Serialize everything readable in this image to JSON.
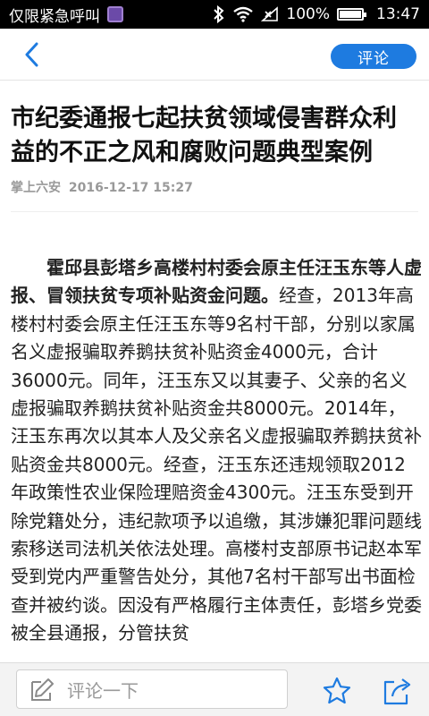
{
  "status_bar": {
    "carrier": "仅限紧急呼叫",
    "battery": "100%",
    "time": "13:47",
    "icons": [
      "app-icon",
      "bluetooth-icon",
      "wifi-icon",
      "no-signal-icon",
      "battery-icon"
    ]
  },
  "nav": {
    "back_icon": "chevron-left-icon",
    "comment_label": "评论"
  },
  "article": {
    "title": "市纪委通报七起扶贫领域侵害群众利益的不正之风和腐败问题典型案例",
    "source": "掌上六安",
    "datetime": "2016-12-17 15:27",
    "lead": "霍邱县彭塔乡高楼村村委会原主任汪玉东等人虚报、冒领扶贫专项补贴资金问题。",
    "body": "经查，2013年高楼村村委会原主任汪玉东等9名村干部，分别以家属名义虚报骗取养鹅扶贫补贴资金4000元，合计36000元。同年，汪玉东又以其妻子、父亲的名义虚报骗取养鹅扶贫补贴资金共8000元。2014年，汪玉东再次以其本人及父亲名义虚报骗取养鹅扶贫补贴资金共8000元。经查，汪玉东还违规领取2012年政策性农业保险理赔资金4300元。汪玉东受到开除党籍处分，违纪款项予以追缴，其涉嫌犯罪问题线索移送司法机关依法处理。高楼村支部原书记赵本军受到党内严重警告处分，其他7名村干部写出书面检查并被约谈。因没有严格履行主体责任，彭塔乡党委被全县通报，分管扶贫"
  },
  "bottom_bar": {
    "comment_placeholder": "评论一下",
    "icons": [
      "edit-icon",
      "star-icon",
      "share-icon"
    ]
  },
  "colors": {
    "accent": "#1e7be0",
    "status_bar_bg": "#000000",
    "meta_text": "#999999"
  }
}
